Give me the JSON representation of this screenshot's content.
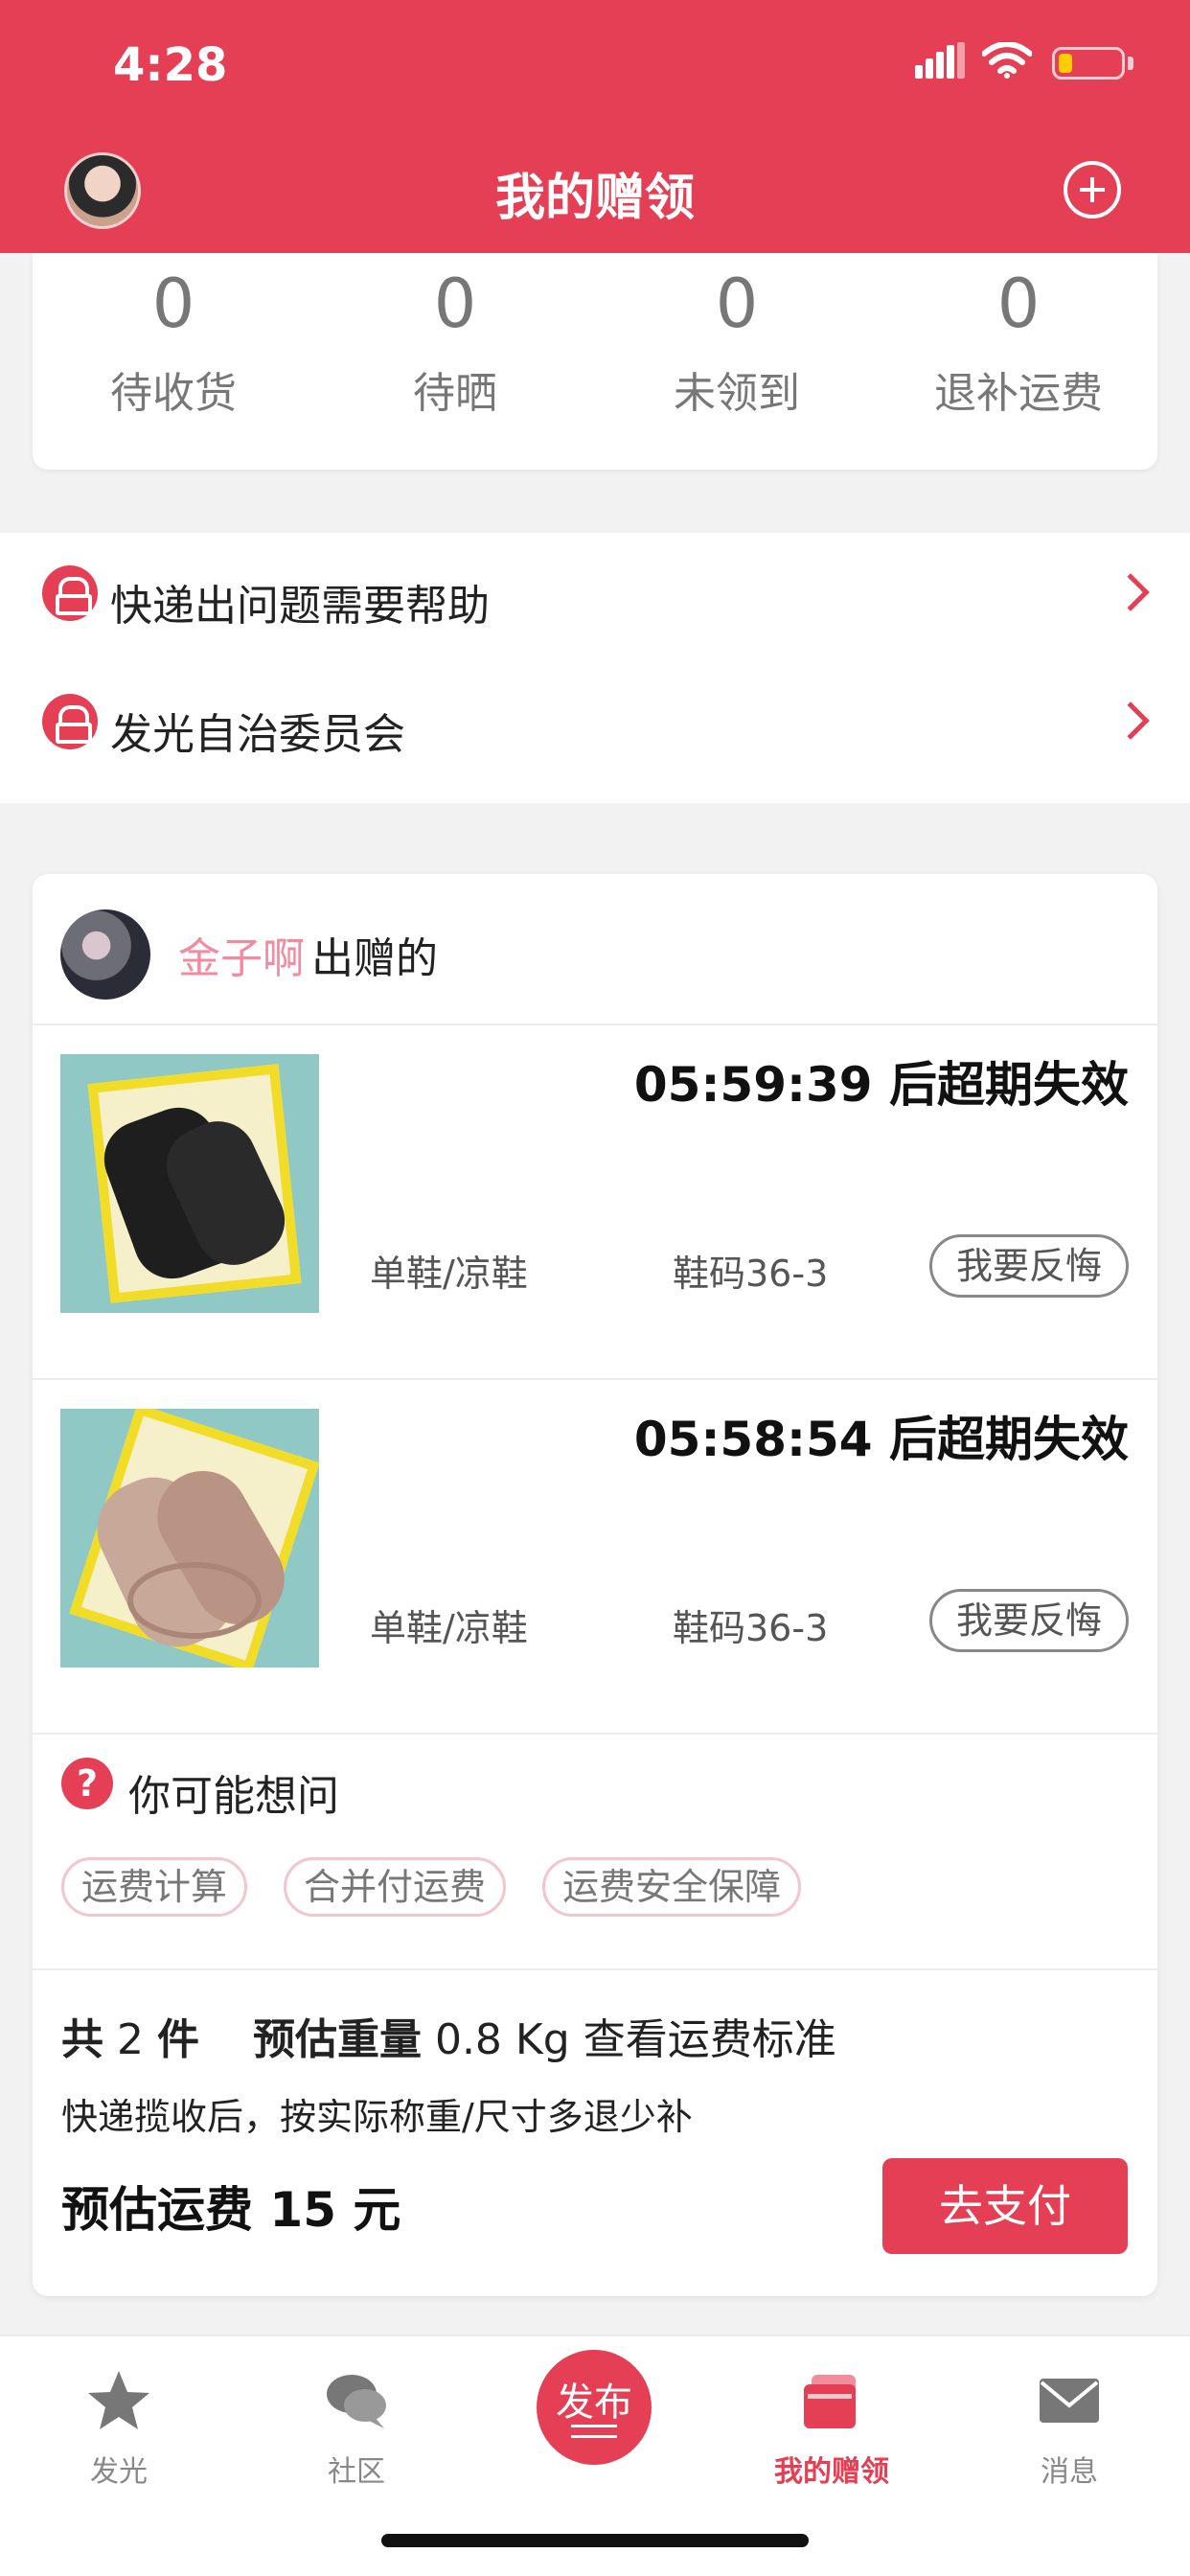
{
  "status_bar": {
    "time": "4:28"
  },
  "header": {
    "title": "我的赠领"
  },
  "stats": [
    {
      "value": "0",
      "label": "待收货"
    },
    {
      "value": "0",
      "label": "待晒"
    },
    {
      "value": "0",
      "label": "未领到"
    },
    {
      "value": "0",
      "label": "退补运费"
    }
  ],
  "help": [
    {
      "label": "快递出问题需要帮助"
    },
    {
      "label": "发光自治委员会"
    }
  ],
  "order": {
    "giver_name": "金子啊",
    "giver_suffix": "出赠的",
    "items": [
      {
        "timer": "05:59:39 后超期失效",
        "category": "单鞋/凉鞋",
        "size": "鞋码36-3",
        "regret_label": "我要反悔"
      },
      {
        "timer": "05:58:54 后超期失效",
        "category": "单鞋/凉鞋",
        "size": "鞋码36-3",
        "regret_label": "我要反悔"
      }
    ],
    "faq": {
      "title": "你可能想问",
      "chips": [
        "运费计算",
        "合并付运费",
        "运费安全保障"
      ]
    },
    "summary": {
      "count_prefix": "共",
      "count": "2",
      "count_unit": "件",
      "weight_label": "预估重量",
      "weight_value": "0.8 Kg",
      "standard_link": "查看运费标准",
      "note": "快递揽收后，按实际称重/尺寸多退少补",
      "fee_text": "预估运费 15 元",
      "pay_label": "去支付"
    }
  },
  "tabbar": {
    "tabs": [
      {
        "label": "发光",
        "icon": "star-icon"
      },
      {
        "label": "社区",
        "icon": "chat-bubbles-icon"
      },
      {
        "label": "我的赠领",
        "icon": "gift-box-icon"
      },
      {
        "label": "消息",
        "icon": "envelope-icon"
      }
    ],
    "publish_label": "发布"
  },
  "colors": {
    "brand": "#e43f55",
    "chip_border": "#f3c5cd",
    "giver_name": "#f18ca0"
  }
}
